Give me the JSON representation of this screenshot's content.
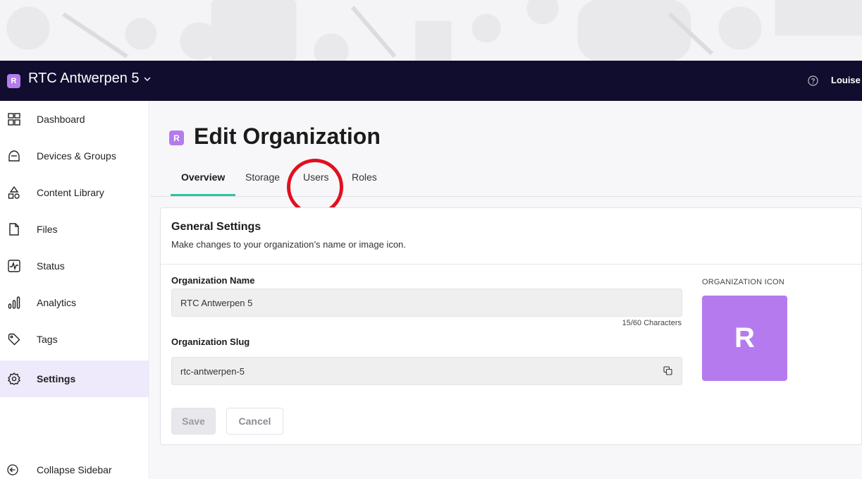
{
  "header": {
    "org_badge": "R",
    "org_name": "RTC Antwerpen 5",
    "user_name": "Louise"
  },
  "sidebar": {
    "items": [
      {
        "label": "Dashboard",
        "icon": "dashboard-icon"
      },
      {
        "label": "Devices & Groups",
        "icon": "devices-icon"
      },
      {
        "label": "Content Library",
        "icon": "content-library-icon"
      },
      {
        "label": "Files",
        "icon": "file-icon"
      },
      {
        "label": "Status",
        "icon": "status-icon"
      },
      {
        "label": "Analytics",
        "icon": "analytics-icon"
      },
      {
        "label": "Tags",
        "icon": "tag-icon"
      },
      {
        "label": "Settings",
        "icon": "gear-icon",
        "active": true
      }
    ],
    "collapse_label": "Collapse Sidebar"
  },
  "main": {
    "title_badge": "R",
    "title": "Edit Organization",
    "tabs": [
      {
        "label": "Overview",
        "active": true
      },
      {
        "label": "Storage"
      },
      {
        "label": "Users"
      },
      {
        "label": "Roles"
      }
    ],
    "card": {
      "title": "General Settings",
      "subtitle": "Make changes to your organization’s name or image icon.",
      "name_label": "Organization Name",
      "name_value": "RTC Antwerpen 5",
      "char_count": "15/60 Characters",
      "slug_label": "Organization Slug",
      "slug_value": "rtc-antwerpen-5",
      "icon_label": "ORGANIZATION ICON",
      "icon_letter": "R",
      "save_label": "Save",
      "cancel_label": "Cancel"
    }
  },
  "colors": {
    "topbar": "#110d2e",
    "brand_purple": "#b57bee",
    "tab_accent": "#2ec4a4",
    "highlight": "#e0101f"
  }
}
